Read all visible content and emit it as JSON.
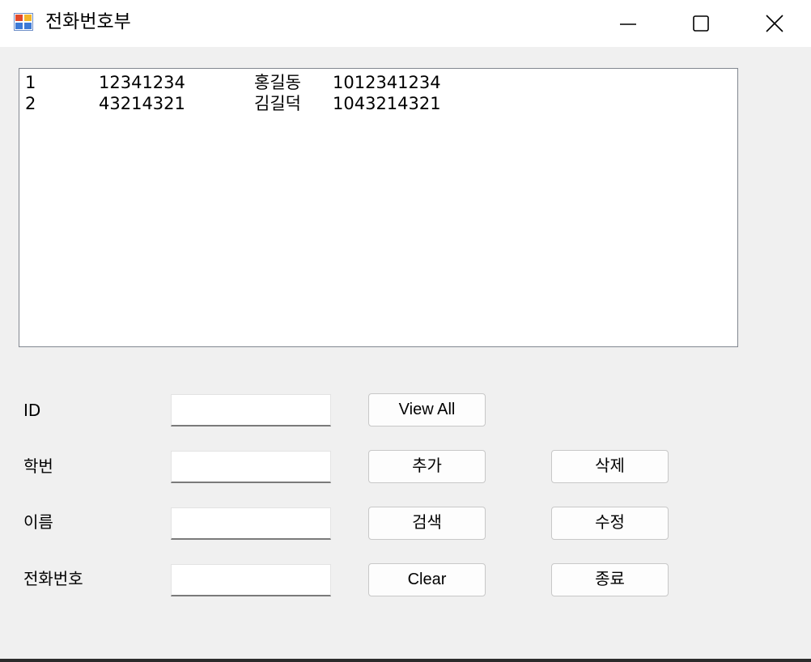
{
  "window": {
    "title": "전화번호부",
    "icon": "form-app-icon",
    "controls": [
      "minimize-icon",
      "maximize-icon",
      "close-icon"
    ]
  },
  "list": {
    "rows": [
      {
        "id": "1",
        "student_no": "12341234",
        "name": "홍길동",
        "phone": "1012341234"
      },
      {
        "id": "2",
        "student_no": "43214321",
        "name": "김길덕",
        "phone": "1043214321"
      }
    ]
  },
  "form": {
    "id_label": "ID",
    "student_no_label": "학번",
    "name_label": "이름",
    "phone_label": "전화번호",
    "id_value": "",
    "student_no_value": "",
    "name_value": "",
    "phone_value": ""
  },
  "buttons": {
    "view_all": "View All",
    "add": "추가",
    "delete": "삭제",
    "search": "검색",
    "edit": "수정",
    "clear": "Clear",
    "exit": "종료"
  }
}
